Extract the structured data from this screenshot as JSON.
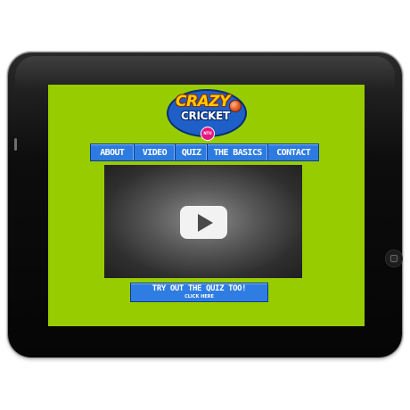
{
  "site": {
    "logo_word1": "CRAZY",
    "logo_word2": "CRICKET",
    "logo_badge": "NTU"
  },
  "nav": {
    "items": [
      {
        "label": "ABOUT"
      },
      {
        "label": "VIDEO"
      },
      {
        "label": "QUIZ"
      },
      {
        "label": "THE BASICS"
      },
      {
        "label": "CONTACT"
      }
    ]
  },
  "cta": {
    "title": "TRY OUT THE QUIZ TOO!",
    "subtitle": "CLICK HERE"
  },
  "colors": {
    "screen_bg": "#97cc00",
    "nav_bg": "#2d7be0",
    "logo_bg": "#1f5fc8",
    "logo_word1": "#ffcc00",
    "badge": "#e8177d"
  },
  "icons": {
    "video": "play-icon",
    "home_button": "home-button-icon"
  }
}
